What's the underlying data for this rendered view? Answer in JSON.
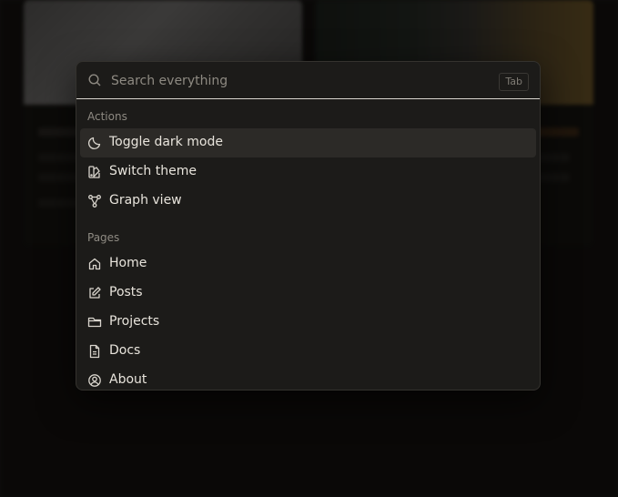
{
  "palette": {
    "search": {
      "placeholder": "Search everything",
      "value": "",
      "shortcut": "Tab"
    },
    "groups": [
      {
        "label": "Actions",
        "items": [
          {
            "label": "Toggle dark mode",
            "icon": "moon-icon",
            "active": true
          },
          {
            "label": "Switch theme",
            "icon": "palette-icon",
            "active": false
          },
          {
            "label": "Graph view",
            "icon": "graph-icon",
            "active": false
          }
        ]
      },
      {
        "label": "Pages",
        "items": [
          {
            "label": "Home",
            "icon": "home-icon"
          },
          {
            "label": "Posts",
            "icon": "edit-icon"
          },
          {
            "label": "Projects",
            "icon": "folder-icon"
          },
          {
            "label": "Docs",
            "icon": "document-icon"
          },
          {
            "label": "About",
            "icon": "user-circle-icon"
          }
        ]
      }
    ]
  },
  "colors": {
    "background": "#0f0e0d",
    "palette_bg": "#1c1b19",
    "active_item_bg": "#2c2a27",
    "text": "#e8e4dc",
    "muted_text": "#8e8a82"
  }
}
